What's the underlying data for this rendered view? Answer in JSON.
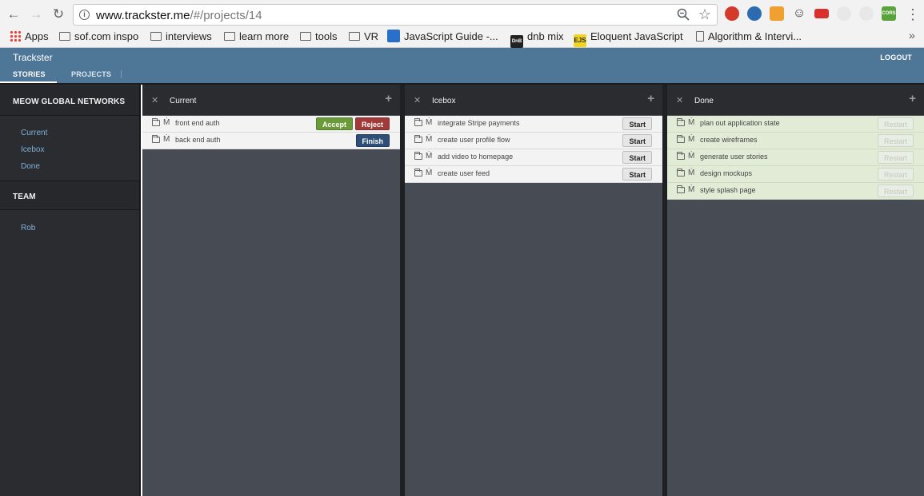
{
  "browser": {
    "url_host": "www.trackster.me",
    "url_path": "/#/projects/14",
    "bookmarks": [
      {
        "label": "Apps",
        "icon": "apps-icon"
      },
      {
        "label": "sof.com inspo",
        "icon": "folder-icon"
      },
      {
        "label": "interviews",
        "icon": "folder-icon"
      },
      {
        "label": "learn more",
        "icon": "folder-icon"
      },
      {
        "label": "tools",
        "icon": "folder-icon"
      },
      {
        "label": "VR",
        "icon": "folder-icon"
      },
      {
        "label": "JavaScript Guide -...",
        "icon": "js-guide-icon"
      },
      {
        "label": "dnb mix",
        "icon": "dnb-icon"
      },
      {
        "label": "Eloquent JavaScript",
        "icon": "ejs-icon"
      },
      {
        "label": "Algorithm & Intervi...",
        "icon": "document-icon"
      }
    ],
    "ejs_badge": "EJS",
    "dnb_badge": "DnB",
    "cors_badge": "CORS"
  },
  "app": {
    "title": "Trackster",
    "logout": "LOGOUT",
    "tabs": [
      "STORIES",
      "PROJECTS"
    ]
  },
  "sidebar": {
    "project_heading": "MEOW GLOBAL NETWORKS",
    "links": [
      "Current",
      "Icebox",
      "Done"
    ],
    "team_heading": "TEAM",
    "members": [
      "Rob"
    ]
  },
  "columns": [
    {
      "title": "Current",
      "stories": [
        {
          "label": "front end auth",
          "actions": [
            "Accept",
            "Reject"
          ]
        },
        {
          "label": "back end auth",
          "actions": [
            "Finish"
          ]
        }
      ]
    },
    {
      "title": "Icebox",
      "stories": [
        {
          "label": "integrate Stripe payments",
          "actions": [
            "Start"
          ]
        },
        {
          "label": "create user profile flow",
          "actions": [
            "Start"
          ]
        },
        {
          "label": "add video to homepage",
          "actions": [
            "Start"
          ]
        },
        {
          "label": "create user feed",
          "actions": [
            "Start"
          ]
        }
      ]
    },
    {
      "title": "Done",
      "stories": [
        {
          "label": "plan out application state",
          "actions": [
            "Restart"
          ]
        },
        {
          "label": "create wireframes",
          "actions": [
            "Restart"
          ]
        },
        {
          "label": "generate user stories",
          "actions": [
            "Restart"
          ]
        },
        {
          "label": "design mockups",
          "actions": [
            "Restart"
          ]
        },
        {
          "label": "style splash page",
          "actions": [
            "Restart"
          ]
        }
      ]
    }
  ],
  "colors": {
    "header": "#4e7697",
    "sidebar": "#2a2c30",
    "column_bg": "#474c54",
    "accept": "#6a9b38",
    "reject": "#a33a3a",
    "finish": "#2e4d77",
    "done_row": "#e1ebd6"
  }
}
